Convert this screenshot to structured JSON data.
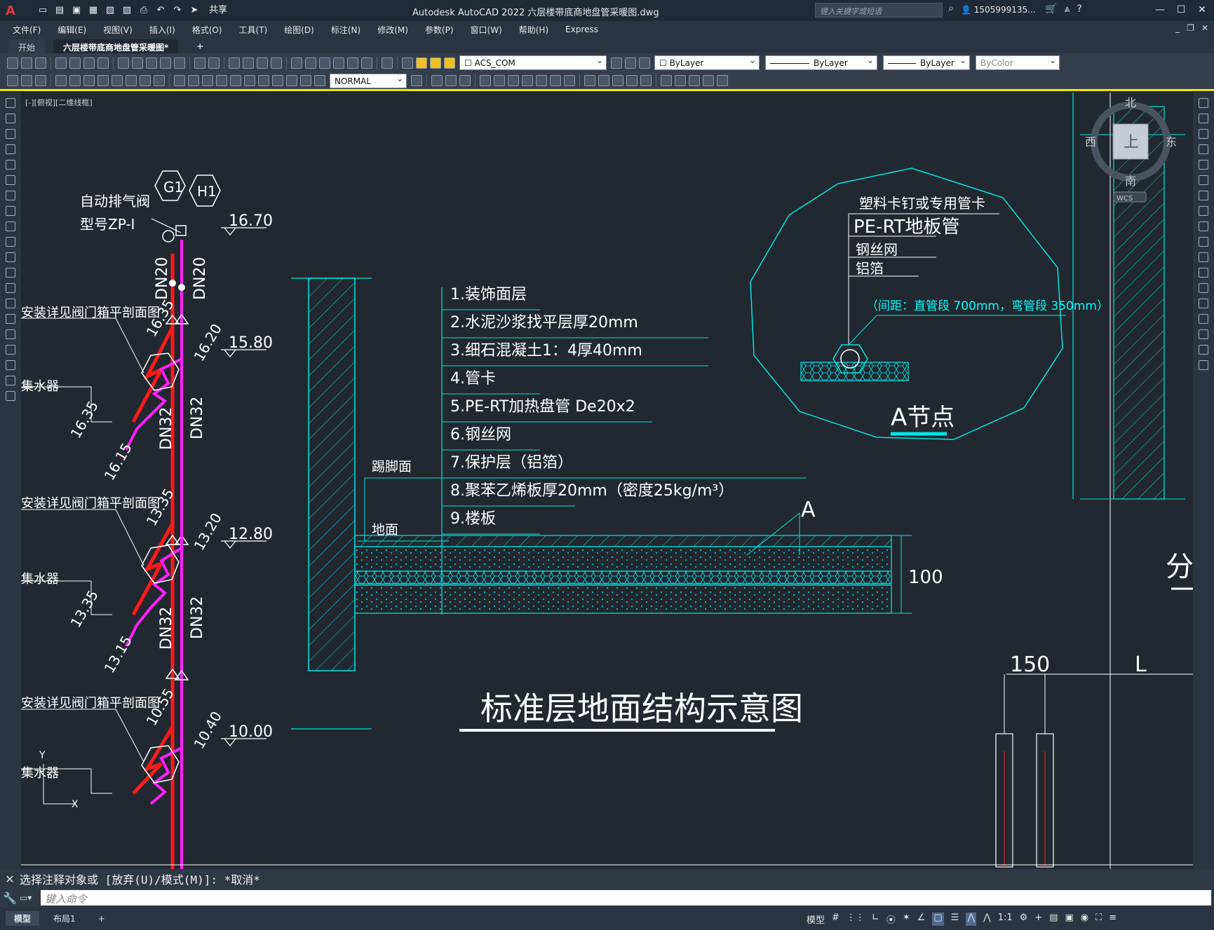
{
  "title_bar": {
    "window_title": "Autodesk AutoCAD 2022    六层楼带底商地盘管采暖图.dwg",
    "share_label": "共享",
    "search_placeholder": "键入关键字或短语",
    "user_name": "1505999135..."
  },
  "menu": [
    "文件(F)",
    "编辑(E)",
    "视图(V)",
    "插入(I)",
    "格式(O)",
    "工具(T)",
    "绘图(D)",
    "标注(N)",
    "修改(M)",
    "参数(P)",
    "窗口(W)",
    "帮助(H)",
    "Express"
  ],
  "tabs": [
    {
      "label": "开始"
    },
    {
      "label": "六层楼带底商地盘管采暖图*"
    },
    {
      "label": "+"
    }
  ],
  "toolbar": {
    "layer_combo": "ACS_COM",
    "color_combo": "ByLayer",
    "linetype_combo": "ByLayer",
    "lineweight_combo": "ByLayer",
    "plotstyle_combo": "ByColor",
    "style_combo": "NORMAL"
  },
  "viewport_label": "[-][俯视][二维线框]",
  "viewcube": {
    "north": "北",
    "south": "南",
    "west": "西",
    "east": "东",
    "top": "上",
    "wcs": "WCS"
  },
  "drawing": {
    "riser": {
      "valve_label_1": "自动排气阀",
      "valve_label_2": "型号ZP-I",
      "tag_g": "G1",
      "tag_h": "H1",
      "dn20_a": "DN20",
      "dn20_b": "DN20",
      "dn32_a": "DN32",
      "dn32_b": "DN32",
      "dn32_c": "DN32",
      "dn32_d": "DN32",
      "elev_1670": "16.70",
      "elev_1580": "15.80",
      "elev_1280": "12.80",
      "elev_1000": "10.00",
      "lbl_1635a": "16.35",
      "lbl_1620": "16.20",
      "lbl_1635b": "16.35",
      "lbl_1615": "16.15",
      "lbl_1335a": "13.35",
      "lbl_1320": "13.20",
      "lbl_1335b": "13.35",
      "lbl_1315": "13.15",
      "lbl_1055": "10.55",
      "lbl_1040": "10.40",
      "valve_ref_1": "安装详见阀门箱平剖面图",
      "valve_ref_2": "安装详见阀门箱平剖面图",
      "valve_ref_3": "安装详见阀门箱平剖面图",
      "collector_1": "集水器",
      "collector_2": "集水器",
      "collector_3": "集水器"
    },
    "section": {
      "layers": [
        "1.装饰面层",
        "2.水泥沙浆找平层厚20mm",
        "3.细石混凝土1：4厚40mm",
        "4.管卡",
        "5.PE-RT加热盘管 De20x2",
        "6.钢丝网",
        "7.保护层（铝箔）",
        "8.聚苯乙烯板厚20mm（密度25kg/m³）",
        "9.楼板"
      ],
      "skirting": "踢脚面",
      "ground": "地面",
      "marker_a": "A",
      "thickness": "100",
      "title": "标准层地面结构示意图"
    },
    "detail": {
      "clip_label": "塑料卡钉或专用管卡",
      "pipe_label": "PE-RT地板管",
      "mesh_label": "钢丝网",
      "foil_label": "铝箔",
      "spacing_note": "（间距：直管段 700mm，弯管段 350mm）",
      "title": "A节点"
    },
    "right_part": {
      "dim_150": "150",
      "dim_l": "L",
      "partial_char": "分"
    },
    "ucs": {
      "x": "X",
      "y": "Y"
    }
  },
  "command": {
    "history": "选择注释对象或 [放弃(U)/模式(M)]: *取消*",
    "placeholder": "键入命令"
  },
  "status": {
    "model_tab": "模型",
    "layout_tab": "布局1",
    "model_label": "模型",
    "scale": "1:1"
  },
  "colors": {
    "accent_red": "#ff0000",
    "accent_magenta": "#ff00ff",
    "cyan": "#00ffff",
    "canvas_bg": "#212830",
    "highlight_yellow": "#f0e800"
  }
}
